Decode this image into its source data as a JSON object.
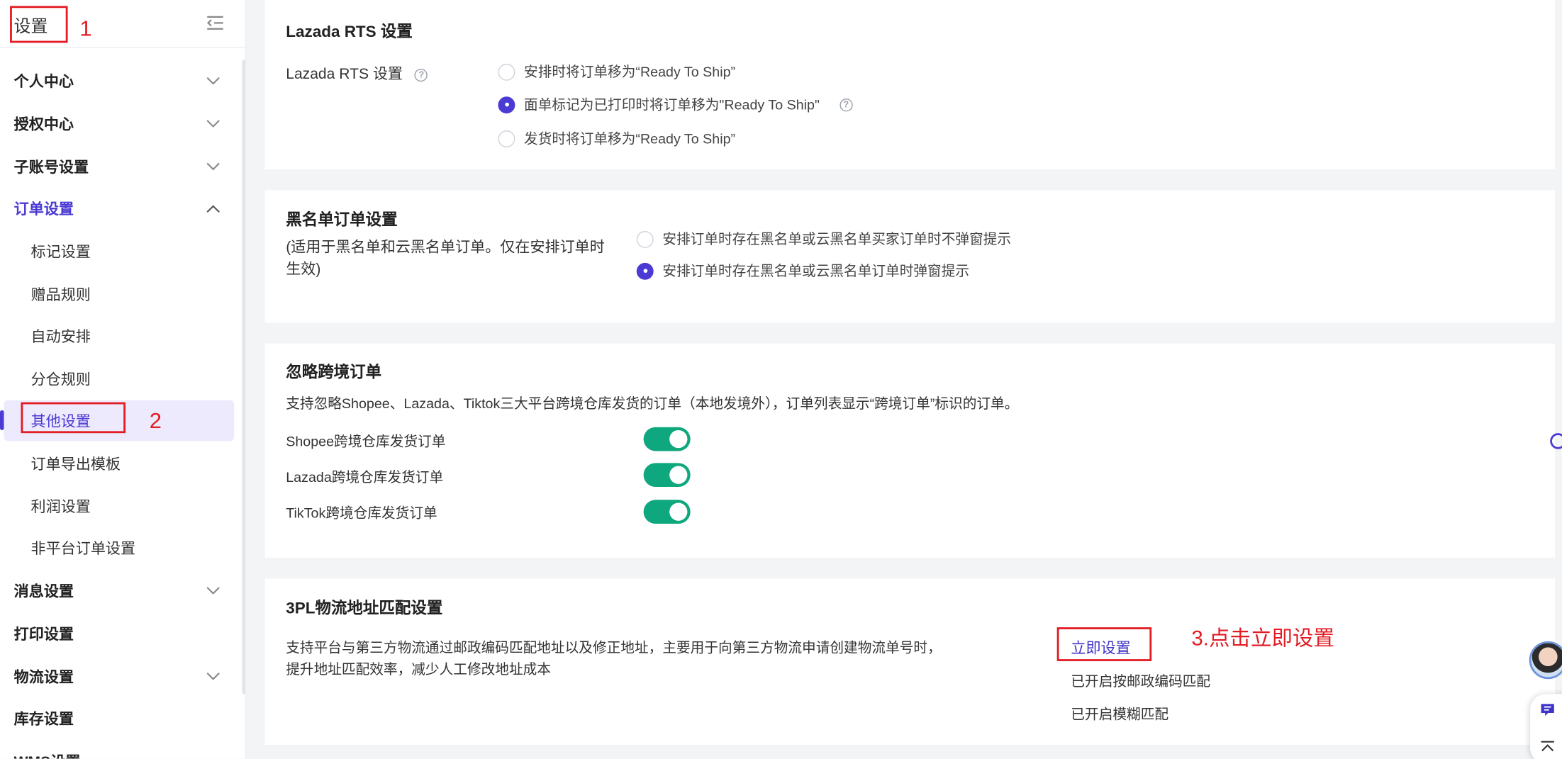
{
  "sidebar": {
    "title": "设置",
    "menu": [
      {
        "label": "个人中心"
      },
      {
        "label": "授权中心"
      },
      {
        "label": "子账号设置"
      },
      {
        "label": "订单设置"
      },
      {
        "label": "消息设置"
      },
      {
        "label": "打印设置"
      },
      {
        "label": "物流设置"
      },
      {
        "label": "库存设置"
      },
      {
        "label": "WMS设置"
      }
    ],
    "order_sub": [
      {
        "label": "标记设置"
      },
      {
        "label": "赠品规则"
      },
      {
        "label": "自动安排"
      },
      {
        "label": "分仓规则"
      },
      {
        "label": "其他设置"
      },
      {
        "label": "订单导出模板"
      },
      {
        "label": "利润设置"
      },
      {
        "label": "非平台订单设置"
      }
    ]
  },
  "lazada": {
    "title": "Lazada RTS 设置",
    "label": "Lazada RTS 设置",
    "options": [
      {
        "label": "安排时将订单移为“Ready To Ship”",
        "selected": false
      },
      {
        "label": "面单标记为已打印时将订单移为\"Ready To Ship\"",
        "selected": true
      },
      {
        "label": "发货时将订单移为“Ready To Ship”",
        "selected": false
      }
    ]
  },
  "blacklist": {
    "title": "黑名单订单设置",
    "desc": "(适用于黑名单和云黑名单订单。仅在安排订单时生效)",
    "options": [
      {
        "label": "安排订单时存在黑名单或云黑名单买家订单时不弹窗提示",
        "selected": false
      },
      {
        "label": "安排订单时存在黑名单或云黑名单订单时弹窗提示",
        "selected": true
      }
    ]
  },
  "crossborder": {
    "title": "忽略跨境订单",
    "desc": "支持忽略Shopee、Lazada、Tiktok三大平台跨境仓库发货的订单（本地发境外），订单列表显示“跨境订单”标识的订单。",
    "toggles": [
      {
        "label": "Shopee跨境仓库发货订单",
        "on": true
      },
      {
        "label": "Lazada跨境仓库发货订单",
        "on": true
      },
      {
        "label": "TikTok跨境仓库发货订单",
        "on": true
      }
    ]
  },
  "tpl": {
    "title": "3PL物流地址匹配设置",
    "desc": "支持平台与第三方物流通过邮政编码匹配地址以及修正地址，主要用于向第三方物流申请创建物流单号时，提升地址匹配效率，减少人工修改地址成本",
    "action": "立即设置",
    "status1": "已开启按邮政编码匹配",
    "status2": "已开启模糊匹配"
  },
  "annotations": {
    "n1": "1",
    "n2": "2",
    "n3": "3.点击立即设置"
  },
  "colors": {
    "accent": "#4b3bd4",
    "toggle_on": "#0fa77d",
    "annotation": "#e31b23"
  }
}
